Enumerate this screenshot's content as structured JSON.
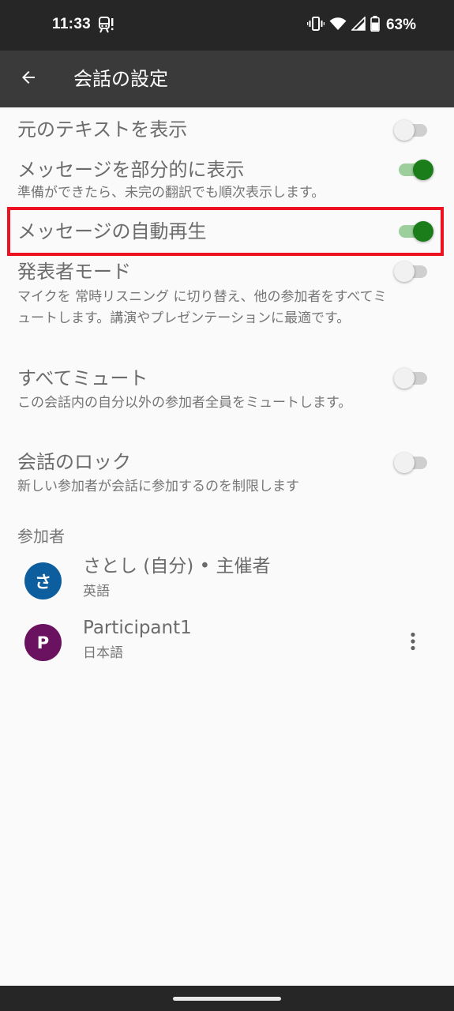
{
  "status_bar": {
    "time": "11:33",
    "battery_percent": "63%",
    "icons": [
      "train-alert-icon",
      "vibrate-icon",
      "wifi-icon",
      "cell-signal-icon",
      "battery-icon"
    ]
  },
  "app_bar": {
    "title": "会話の設定",
    "back_icon": "arrow-back-icon"
  },
  "settings": [
    {
      "title": "元のテキストを表示",
      "description": "",
      "enabled": false
    },
    {
      "title": "メッセージを部分的に表示",
      "description": "準備ができたら、未完の翻訳でも順次表示します。",
      "enabled": true
    },
    {
      "title": "メッセージの自動再生",
      "description": "",
      "enabled": true,
      "highlighted": true
    },
    {
      "title": "発表者モード",
      "description": "マイクを 常時リスニング に切り替え、他の参加者をすべてミュートします。講演やプレゼンテーションに最適です。",
      "enabled": false
    },
    {
      "title": "すべてミュート",
      "description": "この会話内の自分以外の参加者全員をミュートします。",
      "enabled": false
    },
    {
      "title": "会話のロック",
      "description": "新しい参加者が会話に参加するのを制限します",
      "enabled": false
    }
  ],
  "participants_section": {
    "header": "参加者",
    "participants": [
      {
        "initial": "さ",
        "name": "さとし (自分) • 主催者",
        "language": "英語",
        "avatar_color": "#0d5e9e",
        "has_menu": false
      },
      {
        "initial": "P",
        "name": "Participant1",
        "language": "日本語",
        "avatar_color": "#6a1160",
        "has_menu": true
      }
    ]
  },
  "colors": {
    "toggle_on_thumb": "#1a7d1a",
    "toggle_on_track": "#9ccf9c",
    "highlight": "#ee1122"
  }
}
